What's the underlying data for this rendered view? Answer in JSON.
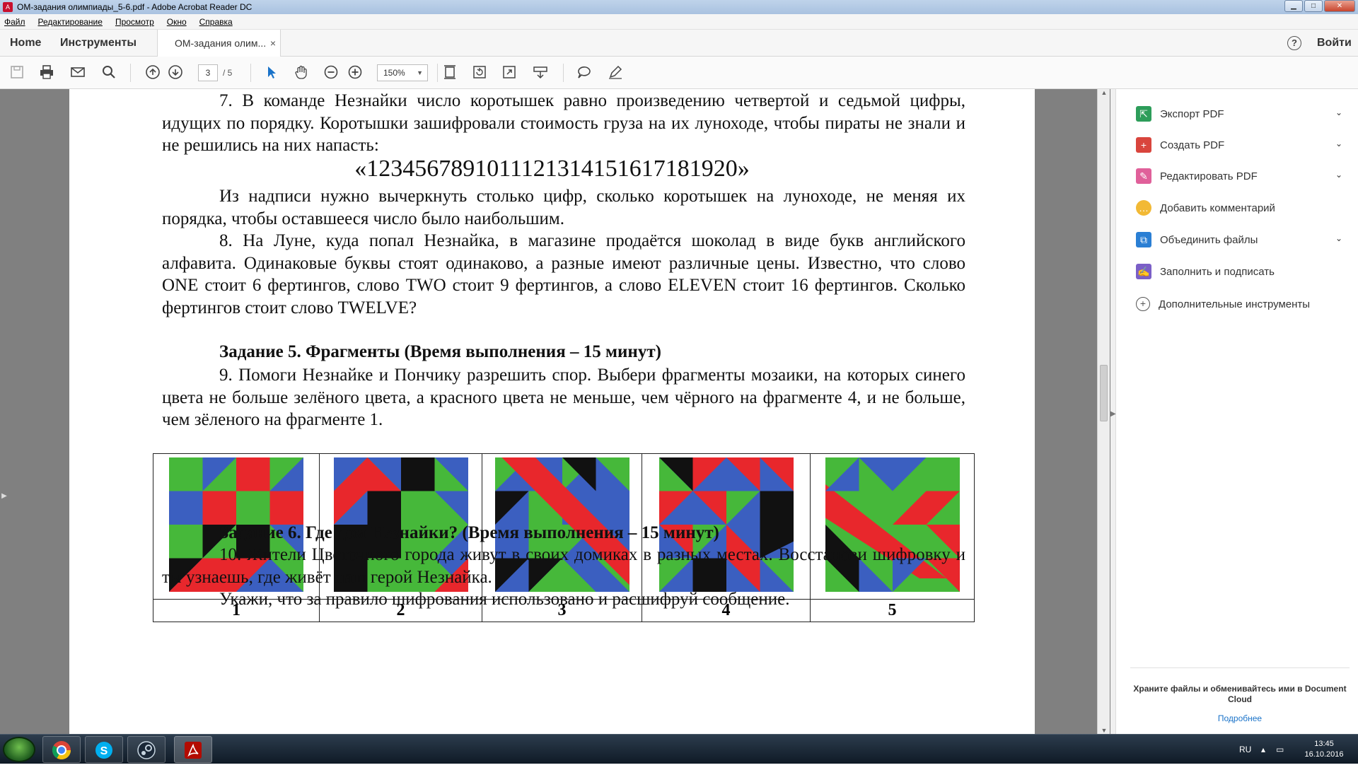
{
  "window": {
    "title": "ОМ-задания олимпиады_5-6.pdf - Adobe Acrobat Reader DC",
    "btn_min": "▁",
    "btn_max": "□",
    "btn_close": "✕"
  },
  "menu": [
    "Файл",
    "Редактирование",
    "Просмотр",
    "Окно",
    "Справка"
  ],
  "tabs": {
    "home": "Home",
    "tools": "Инструменты",
    "document": "ОМ-задания олим...",
    "close": "×",
    "help": "?",
    "signin": "Войти"
  },
  "toolbar": {
    "page_current": "3",
    "page_total": "/ 5",
    "zoom": "150%"
  },
  "doc": {
    "p1": "7. В команде Незнайки число коротышек равно произведению четвертой и седьмой цифры, идущих по порядку. Коротышки зашифровали стоимость груза на их луноходе, чтобы пираты не знали и не решились на них напасть:",
    "sequence": "«1234567891011121314151617181920»",
    "p2": "Из надписи нужно вычеркнуть столько цифр, сколько коротышек на луноходе, не меняя их порядка, чтобы оставшееся число было наибольшим.",
    "p3": "8. На Луне, куда попал Незнайка, в магазине продаётся шоколад в виде букв английского алфавита. Одинаковые буквы стоят одинаково, а разные имеют различные цены. Известно, что слово ONE стоит 6 фертингов, слово TWO стоит 9 фертингов, а слово ELEVEN стоит 16 фертингов. Сколько фертингов стоит слово TWELVE?",
    "h5": "Задание 5. Фрагменты (Время выполнения – 15 минут)",
    "p4": "9. Помоги Незнайке и Пончику разрешить спор. Выбери фрагменты мозаики, на которых синего цвета не больше зелёного цвета, а красного цвета не меньше, чем чёрного на фрагменте 4, и не больше, чем зёленого на фрагменте 1.",
    "fragment_labels": [
      "1",
      "2",
      "3",
      "4",
      "5"
    ],
    "h6": "Задание 6. Где дом Незнайки? (Время выполнения – 15 минут)",
    "p5": "10. Жители Цветочного города живут в своих домиках в разных местах. Восстанови шифровку и ты узнаешь, где живёт наш герой Незнайка.",
    "p6": "Укажи, что за правило шифрования использовано и расшифруй сообщение."
  },
  "right_pane": {
    "items": [
      {
        "label": "Экспорт PDF",
        "icon": "export-pdf-icon",
        "color": "#2d9d5a",
        "chevron": true
      },
      {
        "label": "Создать PDF",
        "icon": "create-pdf-icon",
        "color": "#d9453d",
        "chevron": true
      },
      {
        "label": "Редактировать PDF",
        "icon": "edit-pdf-icon",
        "color": "#e0609a",
        "chevron": true
      },
      {
        "label": "Добавить комментарий",
        "icon": "comment-icon",
        "color": "#f2b935",
        "chevron": false
      },
      {
        "label": "Объединить файлы",
        "icon": "combine-files-icon",
        "color": "#2a7fd4",
        "chevron": true
      },
      {
        "label": "Заполнить и подписать",
        "icon": "fill-sign-icon",
        "color": "#7b5fc7",
        "chevron": false
      },
      {
        "label": "Дополнительные инструменты",
        "icon": "more-tools-icon",
        "color": "#555555",
        "chevron": false
      }
    ],
    "cloud_text": "Храните файлы и обменивайтесь ими в Document Cloud",
    "cloud_link": "Подробнее"
  },
  "taskbar": {
    "lang": "RU",
    "time": "13:45",
    "date": "16.10.2016"
  },
  "colors": {
    "mosaic_blue": "#3b5fc0",
    "mosaic_green": "#46b83a",
    "mosaic_red": "#e8272c",
    "mosaic_black": "#111111"
  }
}
